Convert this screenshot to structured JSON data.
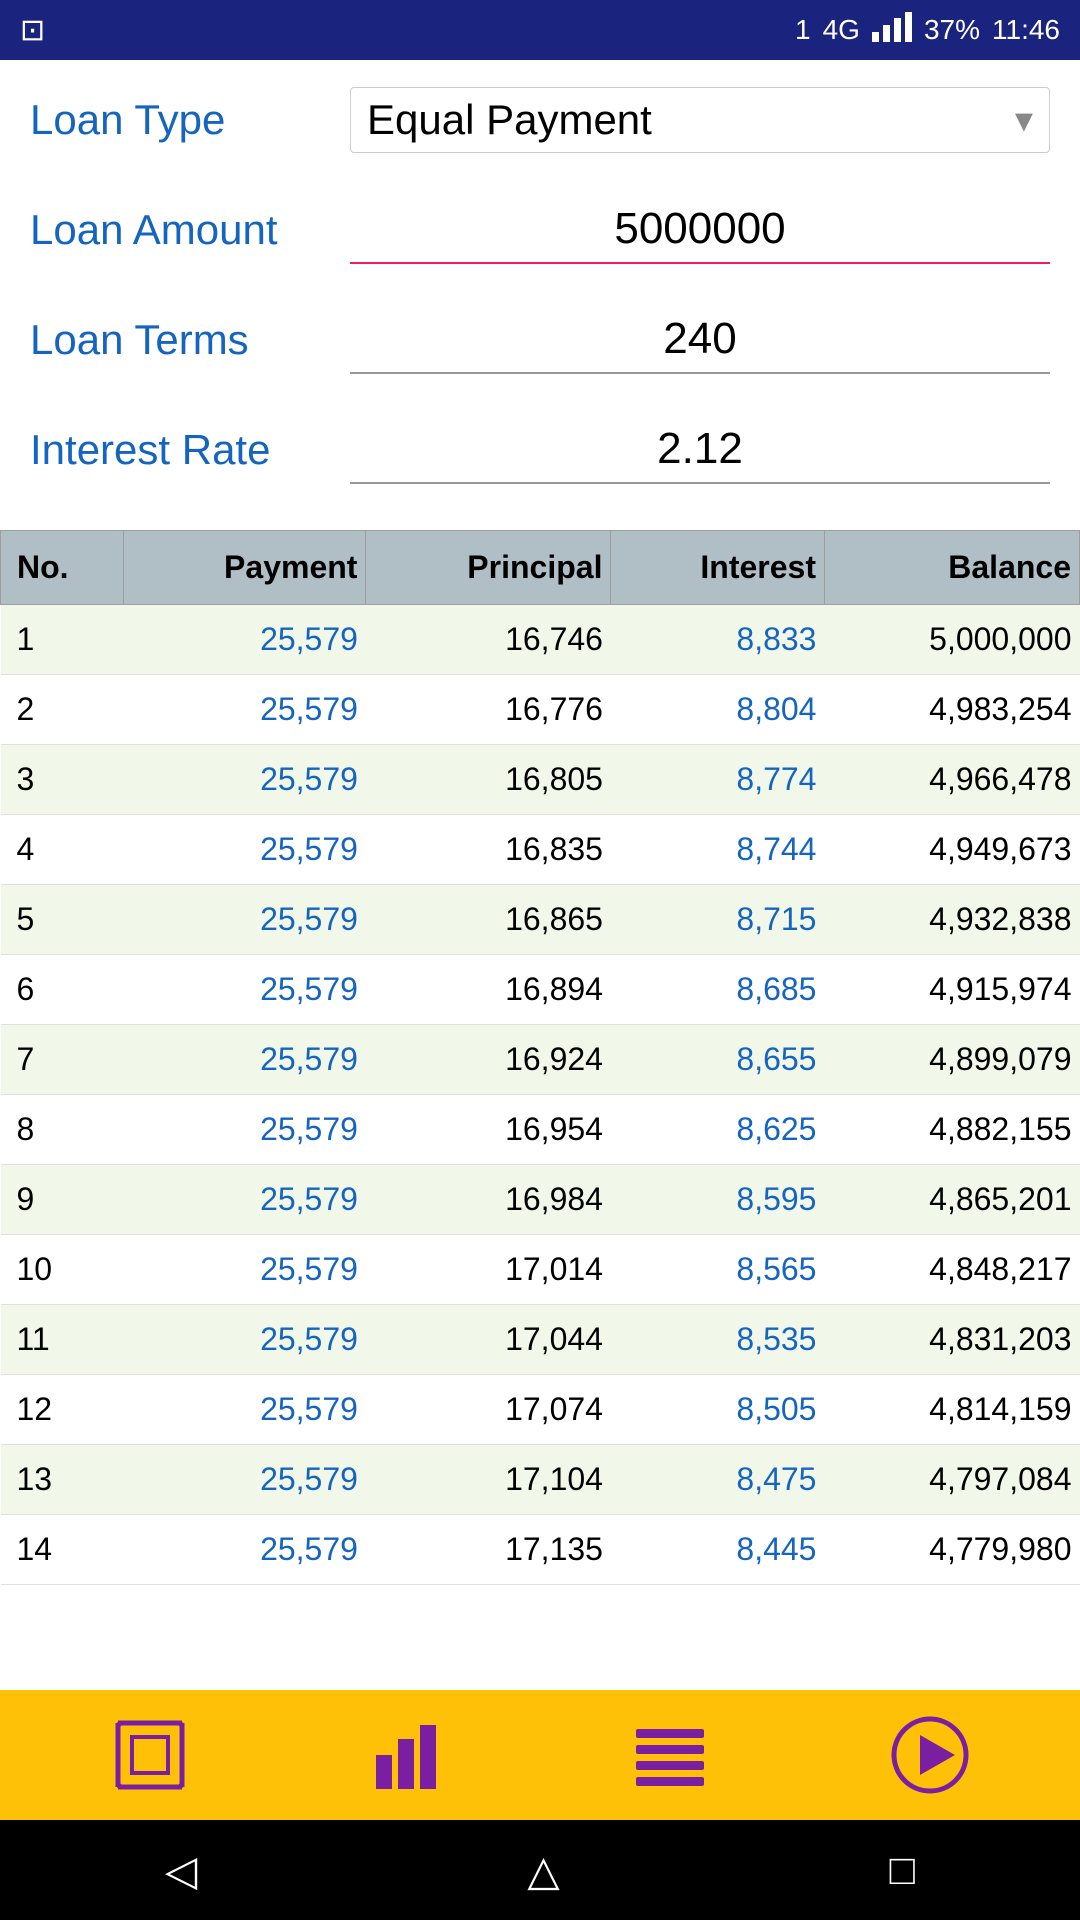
{
  "statusBar": {
    "icon": "⊡",
    "sim": "1",
    "network": "4G",
    "signal": "▂▄▆",
    "battery": "37%",
    "time": "11:46"
  },
  "loanType": {
    "label": "Loan Type",
    "value": "Equal Payment"
  },
  "loanAmount": {
    "label": "Loan Amount",
    "value": "5000000"
  },
  "loanTerms": {
    "label": "Loan Terms",
    "value": "240"
  },
  "interestRate": {
    "label": "Interest Rate",
    "value": "2.12"
  },
  "table": {
    "headers": [
      "No.",
      "Payment",
      "Principal",
      "Interest",
      "Balance"
    ],
    "rows": [
      {
        "no": "1",
        "payment": "25,579",
        "principal": "16,746",
        "interest": "8,833",
        "balance": "5,000,000"
      },
      {
        "no": "2",
        "payment": "25,579",
        "principal": "16,776",
        "interest": "8,804",
        "balance": "4,983,254"
      },
      {
        "no": "3",
        "payment": "25,579",
        "principal": "16,805",
        "interest": "8,774",
        "balance": "4,966,478"
      },
      {
        "no": "4",
        "payment": "25,579",
        "principal": "16,835",
        "interest": "8,744",
        "balance": "4,949,673"
      },
      {
        "no": "5",
        "payment": "25,579",
        "principal": "16,865",
        "interest": "8,715",
        "balance": "4,932,838"
      },
      {
        "no": "6",
        "payment": "25,579",
        "principal": "16,894",
        "interest": "8,685",
        "balance": "4,915,974"
      },
      {
        "no": "7",
        "payment": "25,579",
        "principal": "16,924",
        "interest": "8,655",
        "balance": "4,899,079"
      },
      {
        "no": "8",
        "payment": "25,579",
        "principal": "16,954",
        "interest": "8,625",
        "balance": "4,882,155"
      },
      {
        "no": "9",
        "payment": "25,579",
        "principal": "16,984",
        "interest": "8,595",
        "balance": "4,865,201"
      },
      {
        "no": "10",
        "payment": "25,579",
        "principal": "17,014",
        "interest": "8,565",
        "balance": "4,848,217"
      },
      {
        "no": "11",
        "payment": "25,579",
        "principal": "17,044",
        "interest": "8,535",
        "balance": "4,831,203"
      },
      {
        "no": "12",
        "payment": "25,579",
        "principal": "17,074",
        "interest": "8,505",
        "balance": "4,814,159"
      },
      {
        "no": "13",
        "payment": "25,579",
        "principal": "17,104",
        "interest": "8,475",
        "balance": "4,797,084"
      },
      {
        "no": "14",
        "payment": "25,579",
        "principal": "17,135",
        "interest": "8,445",
        "balance": "4,779,980"
      }
    ]
  },
  "bottomNav": {
    "expand": "⛶",
    "chart": "📊",
    "list": "☰",
    "play": "▶"
  },
  "androidNav": {
    "back": "◁",
    "home": "△",
    "recent": "□"
  }
}
